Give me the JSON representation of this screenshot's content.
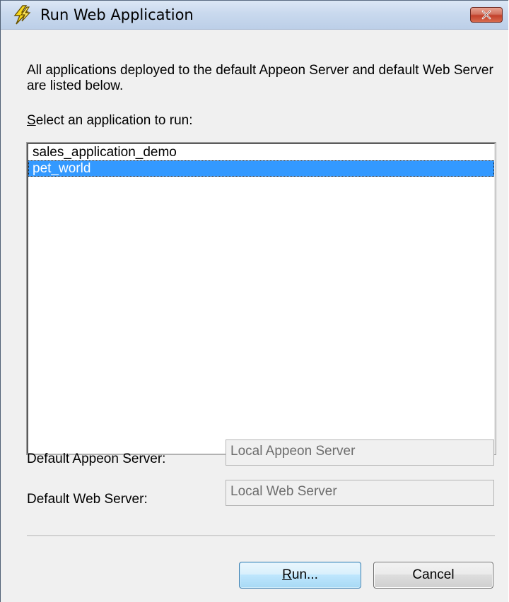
{
  "window": {
    "title": "Run Web Application",
    "icon": "lightning-bolt-icon",
    "close_icon": "close-icon"
  },
  "description": "All applications deployed to the default Appeon Server and default Web Server are listed below.",
  "select_label": {
    "mnemonic": "S",
    "rest": "elect an application to run:"
  },
  "applications": [
    {
      "name": "sales_application_demo",
      "selected": false
    },
    {
      "name": "pet_world",
      "selected": true
    }
  ],
  "fields": {
    "appeon_server_label": "Default Appeon Server:",
    "appeon_server_value": "Local Appeon Server",
    "web_server_label": "Default Web Server:",
    "web_server_value": "Local Web Server"
  },
  "buttons": {
    "run_mnemonic": "R",
    "run_rest": "un...",
    "cancel": "Cancel"
  },
  "colors": {
    "selection": "#3399ff",
    "dialog_background": "#f0f0f0",
    "close_button": "#c2402a"
  }
}
